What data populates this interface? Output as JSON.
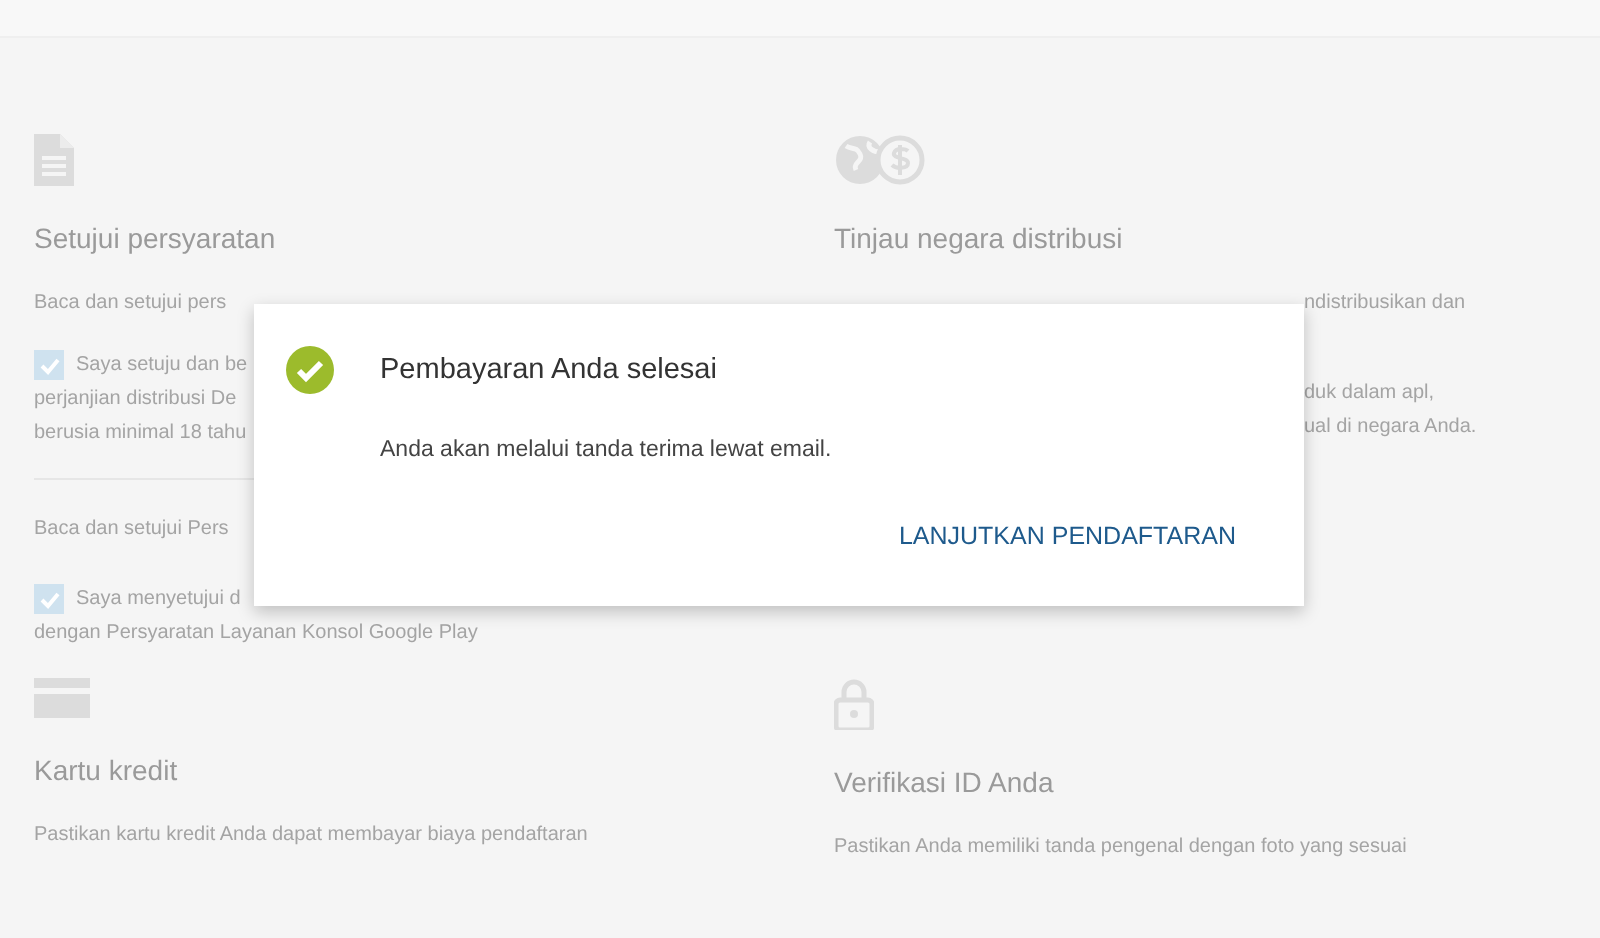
{
  "sections": [
    {
      "title": "Setujui persyaratan",
      "blocks": [
        {
          "kind": "text",
          "lines": [
            "Baca dan setujui pers"
          ]
        },
        {
          "kind": "checkbox",
          "checked": true,
          "lines": [
            "Saya setuju dan be",
            "perjanjian distribusi De",
            "berusia minimal 18 tahu"
          ]
        },
        {
          "kind": "divider"
        },
        {
          "kind": "text",
          "lines": [
            "Baca dan setujui Pers"
          ]
        },
        {
          "kind": "checkbox",
          "checked": true,
          "lines": [
            "Saya menyetujui d",
            "dengan Persyaratan Layanan Konsol Google Play"
          ]
        }
      ]
    },
    {
      "title": "Tinjau negara distribusi",
      "blocks": [
        {
          "kind": "tail",
          "lines": [
            "ndistribusikan dan"
          ]
        },
        {
          "kind": "tail",
          "lines": [
            "duk dalam apl,",
            "ual di negara Anda."
          ]
        }
      ]
    },
    {
      "title": "Kartu kredit",
      "blocks": [
        {
          "kind": "text",
          "lines": [
            "Pastikan kartu kredit Anda dapat membayar biaya pendaftaran"
          ]
        }
      ]
    },
    {
      "title": "Verifikasi ID Anda",
      "blocks": [
        {
          "kind": "text",
          "lines": [
            "Pastikan Anda memiliki tanda pengenal dengan foto yang sesuai"
          ]
        }
      ]
    }
  ],
  "dialog": {
    "title": "Pembayaran Anda selesai",
    "message": "Anda akan melalui tanda terima lewat email.",
    "button": "LANJUTKAN PENDAFTARAN"
  }
}
